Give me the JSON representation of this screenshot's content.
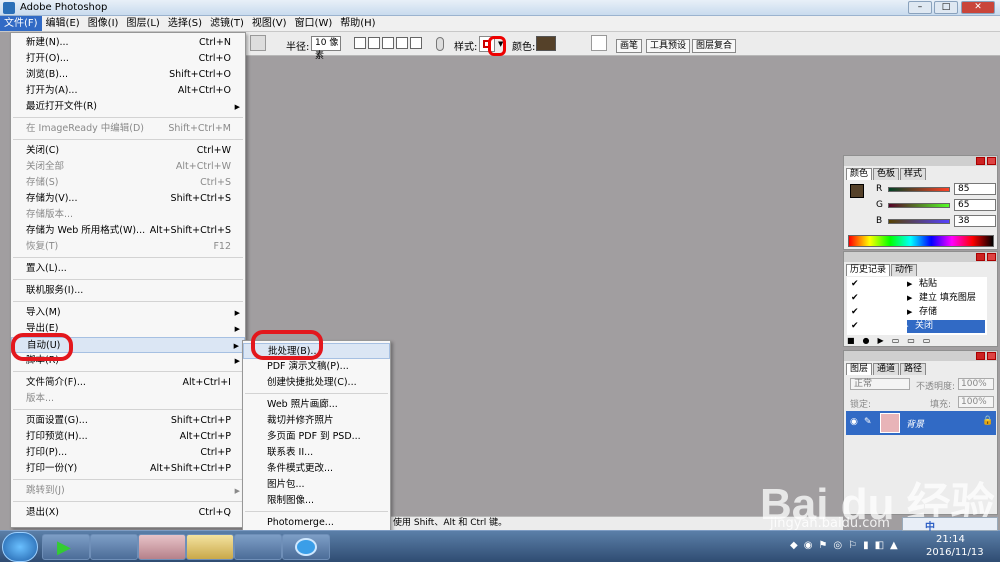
{
  "window": {
    "title": "Adobe Photoshop"
  },
  "menubar": [
    {
      "label": "文件(F)",
      "active": true
    },
    {
      "label": "编辑(E)"
    },
    {
      "label": "图像(I)"
    },
    {
      "label": "图层(L)"
    },
    {
      "label": "选择(S)"
    },
    {
      "label": "滤镜(T)"
    },
    {
      "label": "视图(V)"
    },
    {
      "label": "窗口(W)"
    },
    {
      "label": "帮助(H)"
    }
  ],
  "options": {
    "radius_label": "半径:",
    "radius_value": "10 像素",
    "style_label": "样式:",
    "color_label": "颜色:",
    "color": "#554129",
    "tabs": [
      "画笔",
      "工具预设",
      "图层复合"
    ]
  },
  "file_menu": [
    {
      "label": "新建(N)...",
      "shortcut": "Ctrl+N"
    },
    {
      "label": "打开(O)...",
      "shortcut": "Ctrl+O"
    },
    {
      "label": "浏览(B)...",
      "shortcut": "Shift+Ctrl+O"
    },
    {
      "label": "打开为(A)...",
      "shortcut": "Alt+Ctrl+O"
    },
    {
      "label": "最近打开文件(R)",
      "shortcut": "",
      "submenu": true
    },
    {
      "label": "在 ImageReady 中编辑(D)",
      "shortcut": "Shift+Ctrl+M",
      "disabled": true
    },
    {
      "label": "关闭(C)",
      "shortcut": "Ctrl+W"
    },
    {
      "label": "关闭全部",
      "shortcut": "Alt+Ctrl+W",
      "disabled": true
    },
    {
      "label": "存储(S)",
      "shortcut": "Ctrl+S",
      "disabled": true
    },
    {
      "label": "存储为(V)...",
      "shortcut": "Shift+Ctrl+S"
    },
    {
      "label": "存储版本...",
      "shortcut": "",
      "disabled": true
    },
    {
      "label": "存储为 Web 所用格式(W)...",
      "shortcut": "Alt+Shift+Ctrl+S"
    },
    {
      "label": "恢复(T)",
      "shortcut": "F12",
      "disabled": true
    },
    {
      "label": "置入(L)...",
      "shortcut": ""
    },
    {
      "label": "联机服务(I)...",
      "shortcut": ""
    },
    {
      "label": "导入(M)",
      "shortcut": "",
      "submenu": true
    },
    {
      "label": "导出(E)",
      "shortcut": "",
      "submenu": true
    },
    {
      "label": "自动(U)",
      "shortcut": "",
      "submenu": true,
      "highlight": true
    },
    {
      "label": "脚本(R)",
      "shortcut": "",
      "submenu": true
    },
    {
      "label": "文件简介(F)...",
      "shortcut": "Alt+Ctrl+I"
    },
    {
      "label": "版本...",
      "shortcut": "",
      "disabled": true
    },
    {
      "label": "页面设置(G)...",
      "shortcut": "Shift+Ctrl+P"
    },
    {
      "label": "打印预览(H)...",
      "shortcut": "Alt+Ctrl+P"
    },
    {
      "label": "打印(P)...",
      "shortcut": "Ctrl+P"
    },
    {
      "label": "打印一份(Y)",
      "shortcut": "Alt+Shift+Ctrl+P"
    },
    {
      "label": "跳转到(J)",
      "shortcut": "",
      "submenu": true,
      "disabled": true
    },
    {
      "label": "退出(X)",
      "shortcut": "Ctrl+Q"
    }
  ],
  "auto_submenu": [
    {
      "label": "批处理(B)...",
      "highlight": true
    },
    {
      "label": "PDF 演示文稿(P)..."
    },
    {
      "label": "创建快捷批处理(C)..."
    },
    {
      "label": "Web 照片画廊..."
    },
    {
      "label": "裁切并修齐照片"
    },
    {
      "label": "多页面 PDF 到 PSD..."
    },
    {
      "label": "联系表 II..."
    },
    {
      "label": "条件模式更改..."
    },
    {
      "label": "图片包..."
    },
    {
      "label": "限制图像..."
    },
    {
      "label": "Photomerge..."
    }
  ],
  "color_panel": {
    "tabs": [
      "颜色",
      "色板",
      "样式"
    ],
    "channels": [
      {
        "label": "R",
        "value": "85"
      },
      {
        "label": "G",
        "value": "65"
      },
      {
        "label": "B",
        "value": "38"
      }
    ]
  },
  "history_panel": {
    "tabs": [
      "历史记录",
      "动作"
    ],
    "items": [
      "粘贴",
      "建立 填充图层",
      "存储",
      "关闭"
    ]
  },
  "layers_panel": {
    "tabs": [
      "图层",
      "通道",
      "路径"
    ],
    "blend_mode": "正常",
    "opacity_label": "不透明度:",
    "opacity_value": "100%",
    "lock_label": "锁定:",
    "fill_label": "填充:",
    "fill_value": "100%",
    "layer_name": "背景"
  },
  "status": {
    "hint": "使用 Shift、Alt 和 Ctrl 键。"
  },
  "tray": {
    "time": "21:14",
    "date": "2016/11/13",
    "ime": "中"
  },
  "watermark": {
    "text": "Bai du 经验",
    "url": "jingyan.baidu.com"
  }
}
